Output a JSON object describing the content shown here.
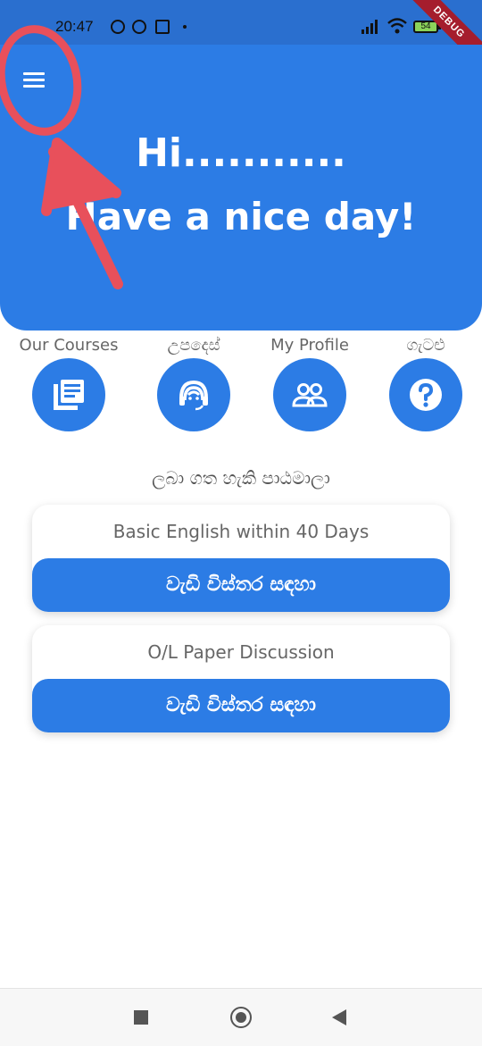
{
  "status_bar": {
    "time": "20:47",
    "battery": "54",
    "debug_label": "DEBUG"
  },
  "header": {
    "greeting": "Hi...........",
    "message": "Have a nice day!"
  },
  "quick_actions": [
    {
      "label": "Our Courses",
      "icon": "book-icon"
    },
    {
      "label": "උපදෙස්",
      "icon": "support-agent-icon"
    },
    {
      "label": "My Profile",
      "icon": "people-icon"
    },
    {
      "label": "ගැටළු",
      "icon": "help-icon"
    }
  ],
  "section": {
    "title": "ලබා ගත හැකි පාඨමාලා"
  },
  "courses": [
    {
      "title": "Basic English within 40 Days",
      "button": "වැඩි විස්තර සඳහා"
    },
    {
      "title": "O/L Paper Discussion",
      "button": "වැඩි විස්තර සඳහා"
    }
  ],
  "colors": {
    "primary": "#2c7ce5",
    "annotation": "#e8505b"
  }
}
